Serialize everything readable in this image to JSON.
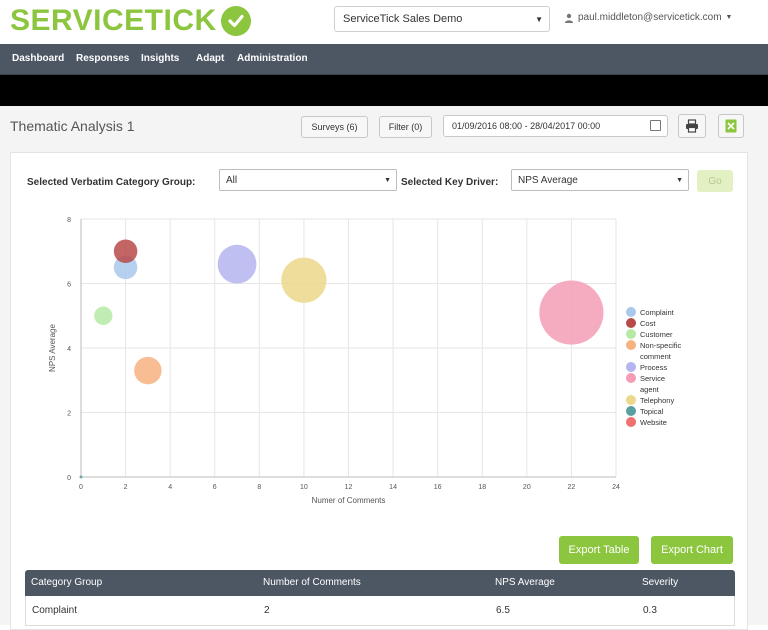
{
  "brand": {
    "logo_part1": "SERVICE",
    "logo_part2": "TICK",
    "color": "#8cc63f"
  },
  "header": {
    "demo_select": "ServiceTick Sales Demo",
    "user_email": "paul.middleton@servicetick.com"
  },
  "nav": {
    "items": [
      "Dashboard",
      "Responses",
      "Insights",
      "Adapt",
      "Administration"
    ]
  },
  "page": {
    "title": "Thematic Analysis 1",
    "surveys_button": "Surveys (6)",
    "filter_button": "Filter (0)",
    "date_range": "01/09/2016 08:00 - 28/04/2017 00:00"
  },
  "filters": {
    "category_group_label": "Selected Verbatim Category Group:",
    "category_group_value": "All",
    "key_driver_label": "Selected Key Driver:",
    "key_driver_value": "NPS Average",
    "go_button": "Go"
  },
  "chart_data": {
    "type": "scatter",
    "xlabel": "Numer of Comments",
    "ylabel": "NPS Average",
    "xlim": [
      0,
      24
    ],
    "ylim": [
      0,
      8
    ],
    "x_ticks": [
      0,
      2,
      4,
      6,
      8,
      10,
      12,
      14,
      16,
      18,
      20,
      22,
      24
    ],
    "y_ticks": [
      0,
      2,
      4,
      6,
      8
    ],
    "grid": true,
    "legend_position": "right",
    "series": [
      {
        "name": "Complaint",
        "color": "#a9c8ec",
        "points": [
          {
            "x": 2,
            "y": 6.5,
            "size": 2
          }
        ]
      },
      {
        "name": "Cost",
        "color": "#b84a4a",
        "points": [
          {
            "x": 2,
            "y": 7.0,
            "size": 2
          }
        ]
      },
      {
        "name": "Customer",
        "color": "#b6eaa4",
        "points": [
          {
            "x": 1,
            "y": 5.0,
            "size": 1
          }
        ]
      },
      {
        "name": "Non-specific comment",
        "color": "#f7b27f",
        "points": [
          {
            "x": 3,
            "y": 3.3,
            "size": 3
          }
        ]
      },
      {
        "name": "Process",
        "color": "#b4b4f0",
        "points": [
          {
            "x": 7,
            "y": 6.6,
            "size": 7
          }
        ]
      },
      {
        "name": "Service agent",
        "color": "#f49db5",
        "points": [
          {
            "x": 22,
            "y": 5.1,
            "size": 22
          }
        ]
      },
      {
        "name": "Telephony",
        "color": "#ecd88a",
        "points": [
          {
            "x": 10,
            "y": 6.1,
            "size": 10
          }
        ]
      },
      {
        "name": "Topical",
        "color": "#5aa0a0",
        "points": [
          {
            "x": 0,
            "y": 0,
            "size": 0
          }
        ]
      },
      {
        "name": "Website",
        "color": "#f07070",
        "points": []
      }
    ]
  },
  "actions": {
    "export_table": "Export Table",
    "export_chart": "Export Chart"
  },
  "table": {
    "headers": [
      "Category Group",
      "Number of Comments",
      "NPS Average",
      "Severity"
    ],
    "rows": [
      [
        "Complaint",
        "2",
        "6.5",
        "0.3"
      ]
    ]
  }
}
